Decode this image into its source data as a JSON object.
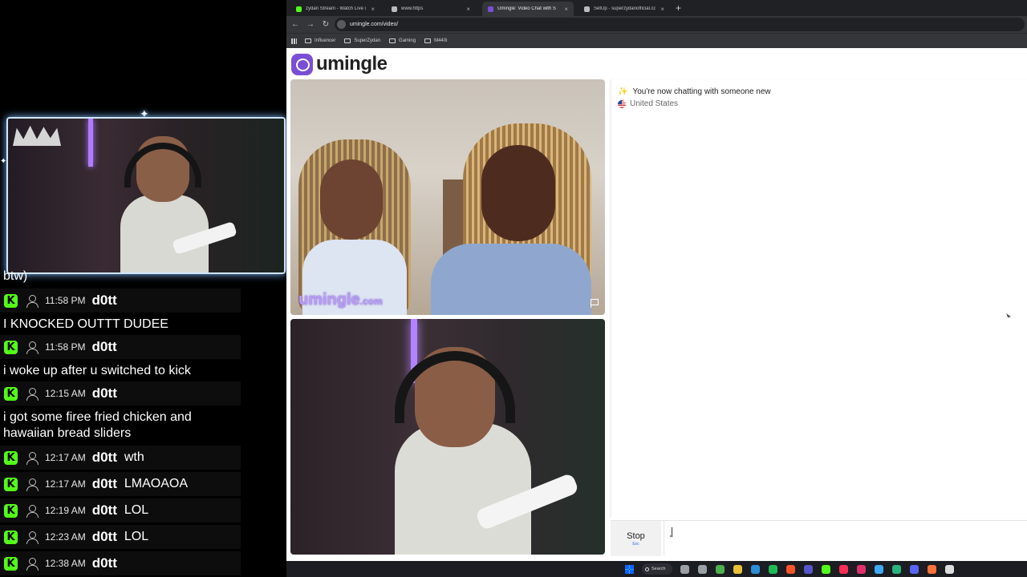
{
  "stream_overlay": {
    "chat_fragment": "btw)",
    "messages": [
      {
        "time": "11:58 PM",
        "user": "d0tt",
        "text": "I KNOCKED OUTTT DUDEE",
        "inline": ""
      },
      {
        "time": "11:58 PM",
        "user": "d0tt",
        "text": "i woke up after u switched to kick",
        "inline": ""
      },
      {
        "time": "12:15 AM",
        "user": "d0tt",
        "text": "i got some firee fried chicken and hawaiian bread sliders",
        "inline": ""
      },
      {
        "time": "12:17 AM",
        "user": "d0tt",
        "text": "",
        "inline": "wth"
      },
      {
        "time": "12:17 AM",
        "user": "d0tt",
        "text": "",
        "inline": "LMAOAOA"
      },
      {
        "time": "12:19 AM",
        "user": "d0tt",
        "text": "",
        "inline": "LOL"
      },
      {
        "time": "12:23 AM",
        "user": "d0tt",
        "text": "",
        "inline": "LOL"
      },
      {
        "time": "12:38 AM",
        "user": "d0tt",
        "text": "",
        "inline": ""
      }
    ],
    "badge_letter": "K",
    "badge_color": "#53fc18"
  },
  "browser": {
    "tabs": [
      {
        "label": "zydan Stream - Watch Live on K",
        "favicon_color": "#53fc18",
        "active": false
      },
      {
        "label": "www.https",
        "favicon_color": "#bbbbbb",
        "active": false
      },
      {
        "label": "Umingle: Video Chat with S",
        "favicon_color": "#7a4fd6",
        "active": true
      },
      {
        "label": "SetUp - superzydanofficial.com",
        "favicon_color": "#bbbbbb",
        "active": false
      }
    ],
    "new_tab": "+",
    "close_glyph": "×",
    "url": "umingle.com/video/",
    "nav": {
      "back": "←",
      "forward": "→",
      "reload": "↻"
    },
    "bookmarks": [
      "Influencer",
      "SuperZydan",
      "Gaming",
      "M440i"
    ]
  },
  "site": {
    "logo_text": "umingle",
    "brand_color": "#7a4fd6",
    "watermark": "umingle",
    "watermark_suffix": ".com",
    "system_message": "You're now chatting with someone new",
    "country": "United States",
    "stop_label": "Stop",
    "stop_key": "Esc",
    "input_value": "\""
  },
  "taskbar": {
    "search_label": "Search",
    "icons": [
      "start-icon",
      "search-icon",
      "task-view-icon",
      "widgets-icon",
      "chrome-icon",
      "file-explorer-icon",
      "edge-icon",
      "spotify-icon",
      "brave-icon",
      "app-icon",
      "kick-icon",
      "tiktok-icon",
      "instagram-icon",
      "app-icon",
      "app-icon",
      "discord-icon",
      "firefox-icon",
      "media-icon"
    ]
  }
}
